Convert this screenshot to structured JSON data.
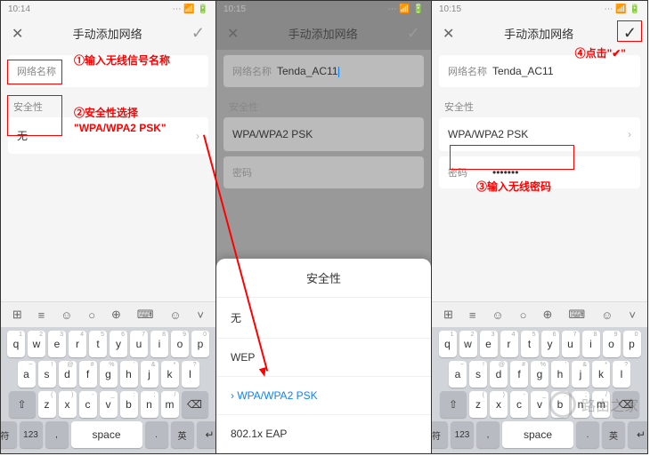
{
  "status": {
    "time1": "10:14",
    "time2": "10:15",
    "time3": "10:15"
  },
  "header": {
    "title": "手动添加网络",
    "close": "✕",
    "confirm": "✓"
  },
  "fields": {
    "name_label": "网络名称",
    "name_value": "Tenda_AC11",
    "security_label": "安全性",
    "security_none": "无",
    "security_wpa": "WPA/WPA2 PSK",
    "password_label": "密码",
    "password_value": "•••••••"
  },
  "sheet": {
    "title": "安全性",
    "options": [
      "无",
      "WEP",
      "WPA/WPA2 PSK",
      "802.1x EAP"
    ]
  },
  "annotations": {
    "a1": "①输入无线信号名称",
    "a2": "②安全性选择",
    "a2b": "\"WPA/WPA2 PSK\"",
    "a3": "③输入无线密码",
    "a4": "④点击\"✔\""
  },
  "keyboard": {
    "row1": [
      "q",
      "w",
      "e",
      "r",
      "t",
      "y",
      "u",
      "i",
      "o",
      "p"
    ],
    "row1alt": [
      "1",
      "2",
      "3",
      "4",
      "5",
      "6",
      "7",
      "8",
      "9",
      "0"
    ],
    "row2": [
      "a",
      "s",
      "d",
      "f",
      "g",
      "h",
      "j",
      "k",
      "l"
    ],
    "row2alt": [
      "~",
      "!",
      "@",
      "#",
      "%",
      "'",
      "&",
      "*",
      "?"
    ],
    "row3": [
      "z",
      "x",
      "c",
      "v",
      "b",
      "n",
      "m"
    ],
    "row3alt": [
      "(",
      ")",
      "-",
      "_",
      ":",
      ";",
      "/"
    ],
    "shift": "⇧",
    "backspace": "⌫",
    "fn_sym": "符",
    "fn_num": "123",
    "fn_comma": ",",
    "space": "space",
    "fn_period": ".",
    "fn_lang": "英",
    "enter": "↵"
  },
  "watermark": {
    "text": "路由之家"
  }
}
